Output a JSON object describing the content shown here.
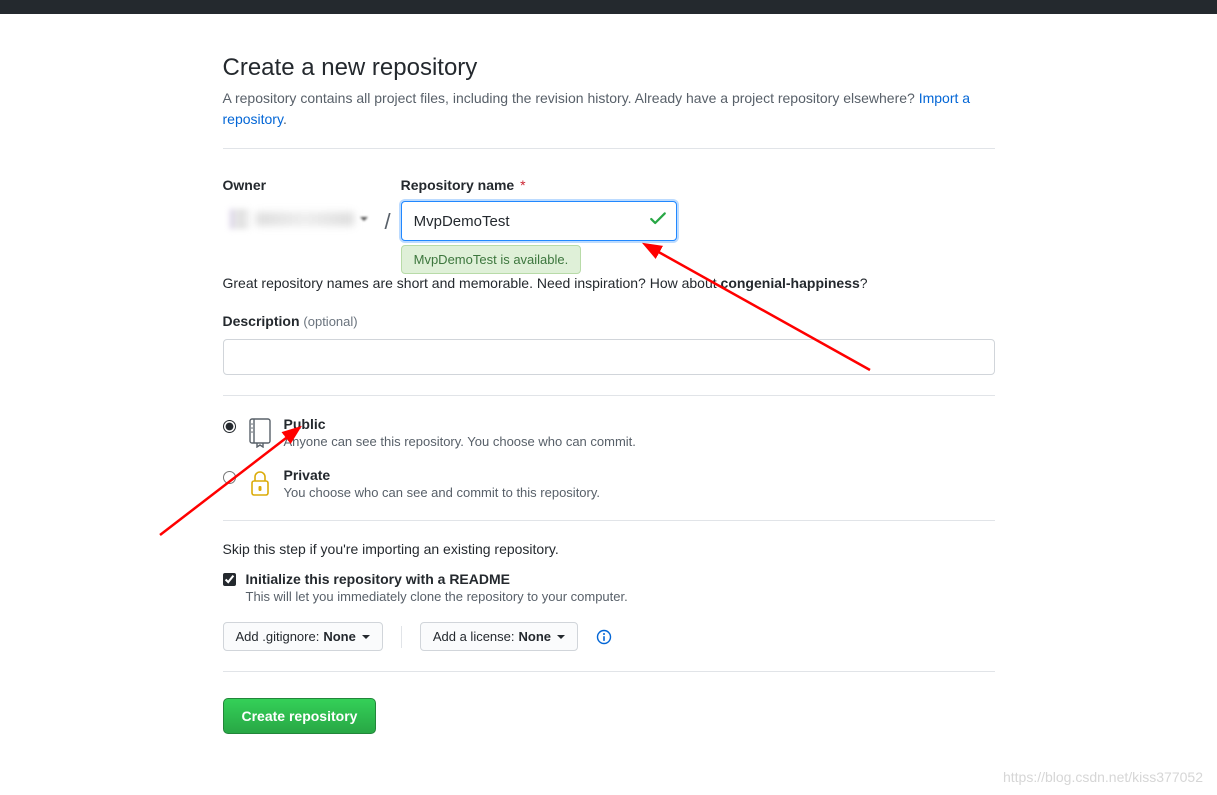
{
  "header": {
    "title": "Create a new repository",
    "lead_before_link": "A repository contains all project files, including the revision history. Already have a project repository elsewhere? ",
    "import_link": "Import a repository",
    "lead_after_link": "."
  },
  "owner": {
    "label": "Owner",
    "slash": "/"
  },
  "repo": {
    "label": "Repository name",
    "required_marker": "*",
    "value": "MvpDemoTest",
    "availability_msg": "MvpDemoTest is available."
  },
  "hint": {
    "prefix": "Great repository names are short and memorable. Need inspiration? How about ",
    "suggestion": "congenial-happiness",
    "suffix": "?"
  },
  "description": {
    "label": "Description",
    "optional_text": "(optional)",
    "value": ""
  },
  "visibility": {
    "public": {
      "title": "Public",
      "sub": "Anyone can see this repository. You choose who can commit.",
      "selected": true
    },
    "private": {
      "title": "Private",
      "sub": "You choose who can see and commit to this repository.",
      "selected": false
    }
  },
  "skip_line": "Skip this step if you're importing an existing repository.",
  "readme": {
    "title": "Initialize this repository with a README",
    "sub": "This will let you immediately clone the repository to your computer.",
    "checked": true
  },
  "selects": {
    "gitignore_prefix": "Add .gitignore: ",
    "gitignore_value": "None",
    "license_prefix": "Add a license: ",
    "license_value": "None"
  },
  "submit": {
    "label": "Create repository"
  },
  "watermark": "https://blog.csdn.net/kiss377052"
}
